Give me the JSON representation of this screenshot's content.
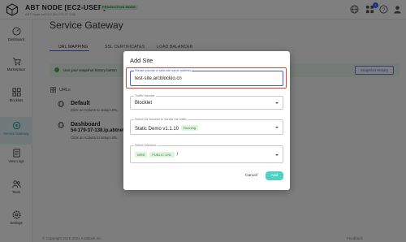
{
  "header": {
    "title": "ABT NODE [EC2-USER]",
    "subtitle": "ABT Node on EC2 (54.179.37.138)",
    "mode_badge": "PRODUCTION MODE",
    "notification_count": "2",
    "icons": [
      "globe-icon",
      "apps-icon",
      "help-icon",
      "user-icon"
    ]
  },
  "sidebar": {
    "items": [
      {
        "label": "Dashboard",
        "icon": "dashboard-icon"
      },
      {
        "label": "Marketplace",
        "icon": "store-icon"
      },
      {
        "label": "Blocklets",
        "icon": "blocklets-icon"
      },
      {
        "label": "Service Gateway",
        "icon": "gateway-icon",
        "active": true
      },
      {
        "label": "View Logs",
        "icon": "logs-icon"
      },
      {
        "label": "Team",
        "icon": "team-icon"
      },
      {
        "label": "Settings",
        "icon": "settings-icon"
      }
    ]
  },
  "main": {
    "title": "Service Gateway",
    "tabs": [
      "URL MAPPING",
      "SSL CERTIFICATES",
      "LOAD BALANCER"
    ],
    "alert_text": "Use your snapshot history button",
    "snapshot_button": "Snapshot History",
    "urls_label": "URLs",
    "sites": [
      {
        "title": "Default",
        "desc": "Click on Actions to setup URL"
      },
      {
        "title": "Dashboard",
        "subtitle": "54-179-37-138.ip.abtnet.",
        "desc": "Click on Actions to setup URL"
      }
    ],
    "footer_left": "© Copyright 2019-2021 ArcBlock Inc.",
    "footer_right": "Feedback"
  },
  "dialog": {
    "title": "Add Site",
    "domain_field": {
      "legend": "Please provide a valid site name address",
      "value": "test-site.arcblockio.cn"
    },
    "traffic_field": {
      "legend": "Traffic Handler",
      "value": "Blocklet"
    },
    "blocklet_field": {
      "legend": "Select the blocklet to handle the traffic",
      "value": "Static Demo v1.1.10",
      "status": "Running"
    },
    "interface_field": {
      "legend": "Select Interface",
      "chips": [
        "WEB",
        "PUBLIC URL"
      ],
      "value": "/"
    },
    "cancel_label": "Cancel",
    "add_label": "Add"
  },
  "colors": {
    "accent": "#3c5ef0",
    "success": "#2e7d32",
    "highlight": "#e0442b",
    "add_button": "#4fd1c5"
  }
}
